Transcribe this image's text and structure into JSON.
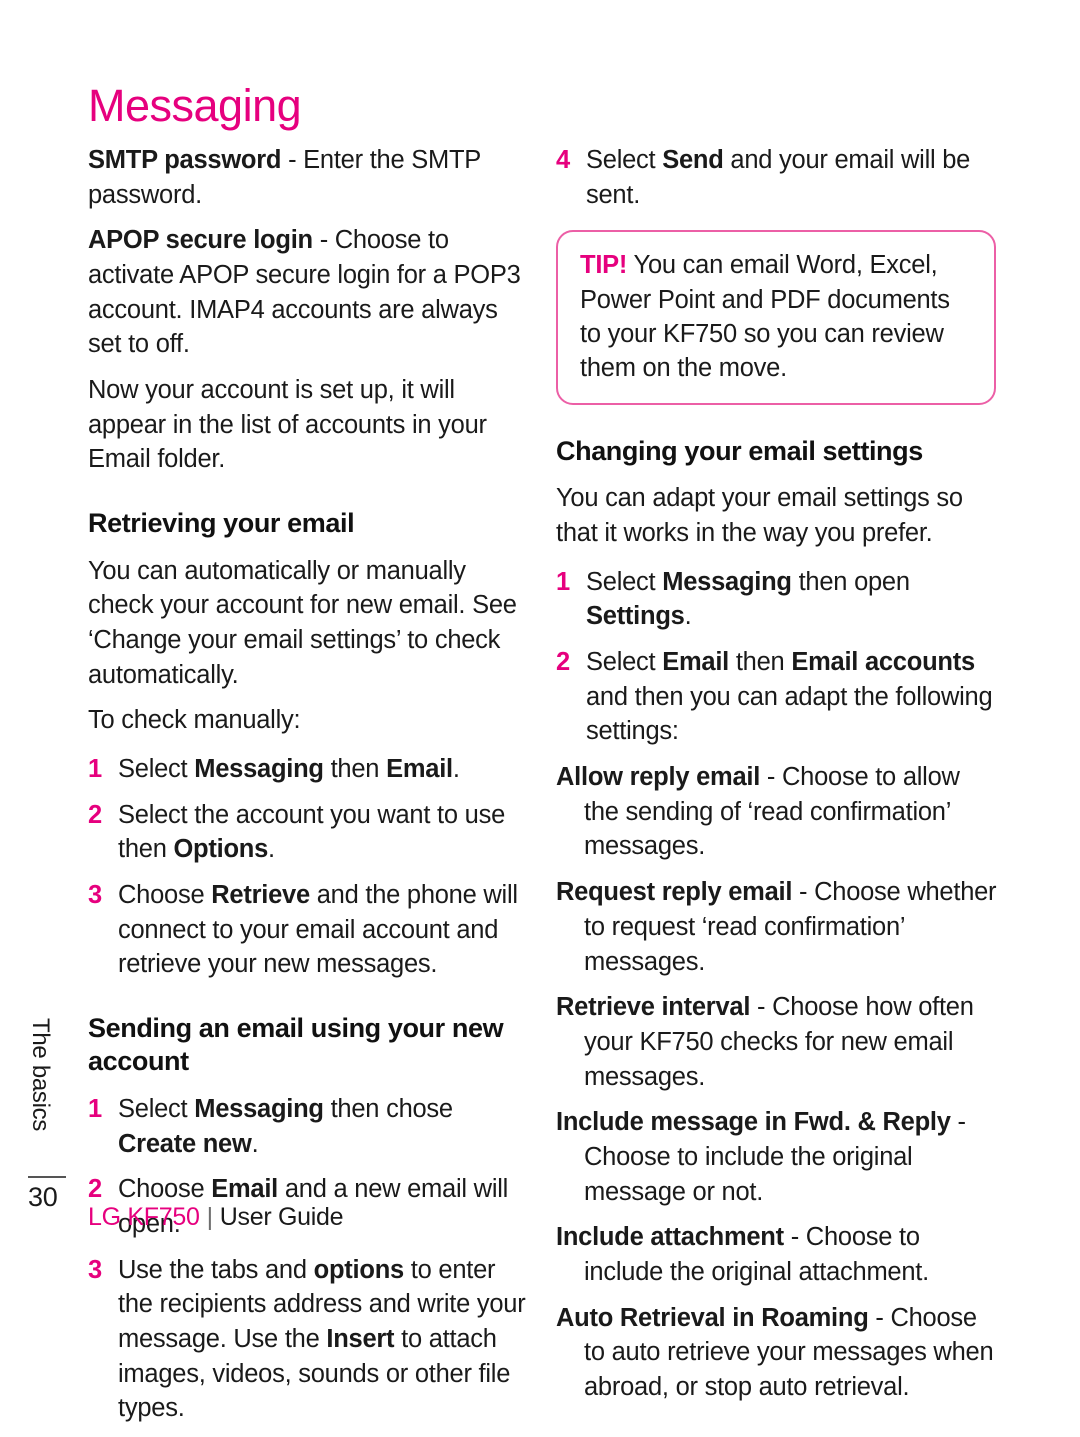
{
  "colors": {
    "accent": "#E6007E",
    "tip_border": "#EC5FA6",
    "text": "#1a1a1a"
  },
  "page_title": "Messaging",
  "left_column": {
    "smtp_password_term": "SMTP password",
    "smtp_password_desc": " - Enter the SMTP password.",
    "apop_term": "APOP secure login",
    "apop_desc": " - Choose to activate APOP secure login for a POP3 account. IMAP4 accounts are always set to off.",
    "account_setup_paragraph": "Now your account is set up, it will appear in the list of accounts in your Email folder.",
    "retrieving_heading": "Retrieving your email",
    "retrieving_paragraph": "You can automatically or manually check your account for new email. See ‘Change your email settings’ to check automatically.",
    "check_manually_label": "To check manually:",
    "retrieve_steps": [
      {
        "num": "1",
        "pre": "Select ",
        "b1": "Messaging",
        "mid": " then ",
        "b2": "Email",
        "post": "."
      },
      {
        "num": "2",
        "pre": "Select the account you want to use then ",
        "b1": "Options",
        "mid": "",
        "b2": "",
        "post": "."
      },
      {
        "num": "3",
        "pre": "Choose ",
        "b1": "Retrieve",
        "mid": " and the phone will connect to your email account and retrieve your new messages.",
        "b2": "",
        "post": ""
      }
    ],
    "sending_heading": "Sending an email using your new account",
    "sending_steps": [
      {
        "num": "1",
        "pre": "Select ",
        "b1": "Messaging",
        "mid": " then chose ",
        "b2": "Create new",
        "post": "."
      },
      {
        "num": "2",
        "pre": "Choose ",
        "b1": "Email",
        "mid": " and a new email will open.",
        "b2": "",
        "post": ""
      },
      {
        "num": "3",
        "pre": "Use the tabs and ",
        "b1": "options",
        "mid": " to enter the recipients address and write your message. Use the ",
        "b2": "Insert",
        "post": " to attach images, videos, sounds or other file types."
      }
    ]
  },
  "right_column": {
    "send_step": {
      "num": "4",
      "pre": "Select ",
      "b1": "Send",
      "post": " and your email will be sent."
    },
    "tip": {
      "label": "TIP!",
      "text": " You can email Word, Excel, Power Point and PDF documents to your KF750 so you can review them on the move."
    },
    "changing_heading": "Changing your email settings",
    "changing_paragraph": "You can adapt your email settings so that it works in the way you prefer.",
    "changing_steps": [
      {
        "num": "1",
        "pre": "Select ",
        "b1": "Messaging",
        "mid": " then open ",
        "b2": "Settings",
        "post": "."
      },
      {
        "num": "2",
        "pre": "Select ",
        "b1": "Email",
        "mid": " then ",
        "b2": "Email accounts",
        "post": " and then you can adapt the following settings:"
      }
    ],
    "settings": [
      {
        "term": "Allow reply email",
        "desc": " - Choose to allow the sending of ‘read confirmation’ messages."
      },
      {
        "term": "Request reply email",
        "desc": " - Choose whether to request ‘read confirmation’ messages."
      },
      {
        "term": "Retrieve interval",
        "desc": " - Choose how often your KF750 checks for new email messages."
      },
      {
        "term": "Include message in Fwd. & Reply",
        "desc": " - Choose to include the original message or not."
      },
      {
        "term": "Include attachment",
        "desc": " - Choose to include the original attachment."
      },
      {
        "term": "Auto Retrieval in Roaming",
        "desc": " - Choose to auto retrieve your messages when abroad, or stop auto retrieval."
      }
    ]
  },
  "side_tab": {
    "chapter": "The basics",
    "page_number": "30"
  },
  "footer": {
    "brand": "LG KF750",
    "separator": "|",
    "guide": "User Guide"
  }
}
